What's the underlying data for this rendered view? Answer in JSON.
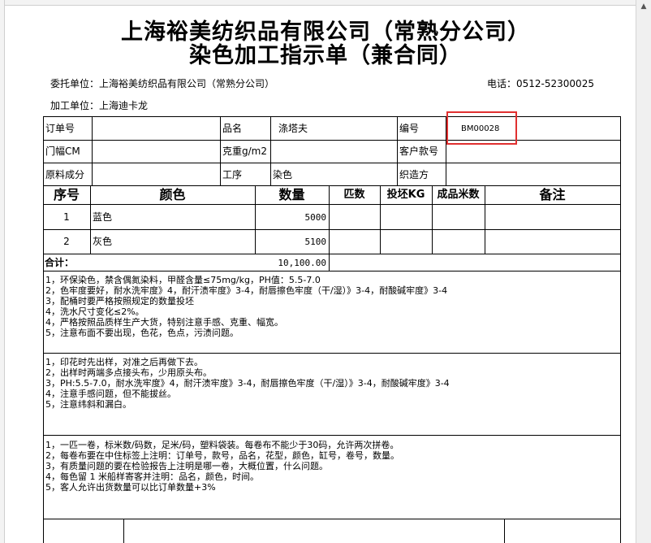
{
  "document": {
    "title_line1": "上海裕美纺织品有限公司（常熟分公司）",
    "title_line2": "染色加工指示单（兼合同）",
    "client_label": "委托单位：",
    "client_value": "上海裕美纺织品有限公司（常熟分公司）",
    "phone_label": "电话：",
    "phone_value": "0512-52300025",
    "processor_label": "加工单位：",
    "processor_value": "上海迪卡龙"
  },
  "order_info": {
    "order_no_label": "订单号",
    "order_no_value": "",
    "product_label": "品名",
    "product_value": "涤塔夫",
    "code_label": "编号",
    "code_value": "BM00028",
    "width_label": "门幅CM",
    "width_value": "",
    "weight_label": "克重g/m2",
    "weight_value": "",
    "customer_style_label": "客户款号",
    "customer_style_value": "",
    "composition_label": "原料成分",
    "composition_value": "",
    "process_label": "工序",
    "process_value": "染色",
    "weave_label": "织造方",
    "weave_value": ""
  },
  "items_table": {
    "headers": [
      "序号",
      "颜色",
      "数量",
      "匹数",
      "投坯KG",
      "成品米数",
      "备注"
    ],
    "rows": [
      {
        "no": "1",
        "color": "蓝色",
        "qty": "5000",
        "pieces": "",
        "grey_kg": "",
        "finished_m": "",
        "remark": ""
      },
      {
        "no": "2",
        "color": "灰色",
        "qty": "5100",
        "pieces": "",
        "grey_kg": "",
        "finished_m": "",
        "remark": ""
      }
    ],
    "total_label": "合计：",
    "total_qty": "10,100.00"
  },
  "notes": {
    "block1": [
      "1，环保染色，禁含偶氮染料，甲醛含量≤75mg/kg，PH值：5.5-7.0",
      "2，色牢度要好，耐水洗牢度》4，耐汗渍牢度》3-4，耐唇擦色牢度（干/湿）》3-4，耐酸碱牢度》3-4",
      "3，配桶时要严格按照规定的数量投坯",
      "4，洗水尺寸变化≤2%。",
      "4，严格按照品质样生产大货，特别注意手感、克重、幅宽。",
      "5，注意布面不要出现，色花，色点，污渍问题。"
    ],
    "block2": [
      "1，印花时先出样，对准之后再做下去。",
      "2，出样时两端多点接头布，少用原头布。",
      "3，PH:5.5-7.0，耐水洗牢度》4，耐汗渍牢度》3-4，耐唇擦色牢度（干/湿）》3-4，耐酸碱牢度》3-4",
      "4，注意手感问题，但不能拔丝。",
      "5，注意纬斜和漏白。"
    ],
    "block3": [
      "1，一匹一卷，标米数/码数，足米/码，塑料袋装。每卷布不能少于30码，允许两次拼卷。",
      "2，每卷布要在中住标签上注明：订单号，款号，品名，花型，颜色，缸号，卷号，数量。",
      "3，有质量问题的要在检验报告上注明是哪一卷，大概位置，什么问题。",
      "4，每色留  1 米船样寄客并注明：品名，颜色，时间。",
      "5，客人允许出货数量可以比订单数量+3%"
    ]
  }
}
